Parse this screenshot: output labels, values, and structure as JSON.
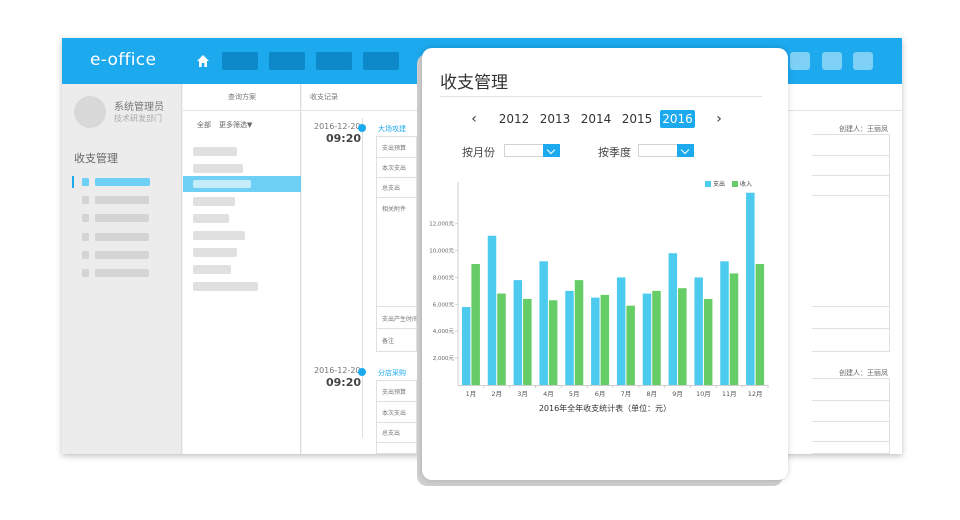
{
  "app": {
    "brand": "e-office",
    "user": {
      "name": "系统管理员",
      "dept": "技术研发部门"
    },
    "sidebar_title": "收支管理",
    "query_title": "查询方案",
    "filter_all": "全部",
    "filter_more": "更多筛选▼",
    "records_title": "收支记录",
    "records": [
      {
        "date": "2016-12-20",
        "time": "09:20",
        "category": "大场攻建",
        "creator": "创建人：王丽凤",
        "fields": [
          "支出预算",
          "本次支出",
          "总支出",
          "相关附件",
          "支出产生时间",
          "备注"
        ]
      },
      {
        "date": "2016-12-20",
        "time": "09:20",
        "category": "分店采购",
        "creator": "创建人：王丽凤",
        "fields": [
          "支出预算",
          "本次支出",
          "总支出"
        ]
      }
    ]
  },
  "card": {
    "title": "收支管理",
    "years": [
      "2012",
      "2013",
      "2014",
      "2015",
      "2016"
    ],
    "active_year": "2016",
    "prev_label": "‹",
    "next_label": "›",
    "filter_month": "按月份",
    "filter_quarter": "按季度"
  },
  "colors": {
    "expense": "#4dcbef",
    "income": "#66cc66",
    "accent": "#1ca9ee"
  },
  "chart_data": {
    "type": "bar",
    "title": "2016年全年收支统计表（单位：元）",
    "categories": [
      "1月",
      "2月",
      "3月",
      "4月",
      "5月",
      "6月",
      "7月",
      "8月",
      "9月",
      "10月",
      "11月",
      "12月"
    ],
    "series": [
      {
        "name": "支出",
        "values": [
          5800,
          11100,
          7800,
          9200,
          7000,
          6500,
          8000,
          6800,
          9800,
          8000,
          9200,
          14300
        ]
      },
      {
        "name": "收入",
        "values": [
          9000,
          6800,
          6400,
          6300,
          7800,
          6700,
          5900,
          7000,
          7200,
          6400,
          8300,
          9000
        ]
      }
    ],
    "yticks": [
      "2,000元",
      "4,000元",
      "6,000元",
      "8,000元",
      "10,000元",
      "12,000元"
    ],
    "ylim": [
      0,
      14800
    ],
    "legend": "top-right",
    "grid": false
  }
}
